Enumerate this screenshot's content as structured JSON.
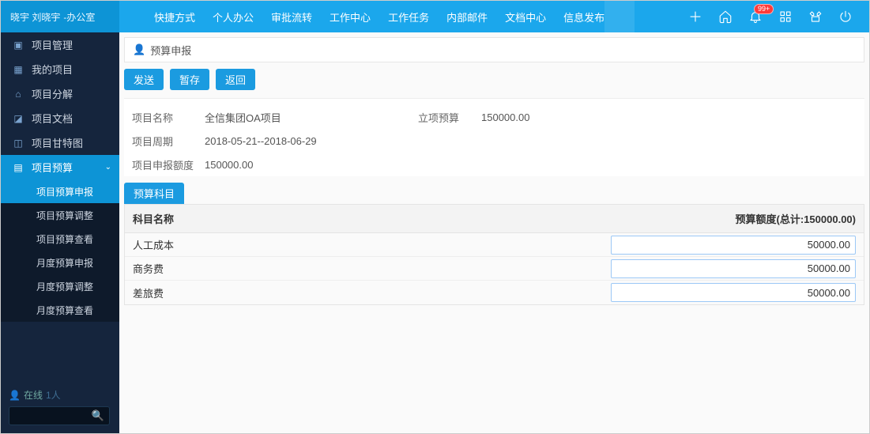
{
  "header": {
    "user_name": "晓宇 刘晓宇",
    "user_dept": "-办公室",
    "badge": "99+"
  },
  "topnav": [
    "快捷方式",
    "个人办公",
    "审批流转",
    "工作中心",
    "工作任务",
    "内部邮件",
    "文档中心",
    "信息发布"
  ],
  "sidebar": {
    "items": [
      "项目管理",
      "我的项目",
      "项目分解",
      "项目文档",
      "项目甘特图",
      "项目预算"
    ],
    "subs": [
      "项目预算申报",
      "项目预算调整",
      "项目预算查看",
      "月度预算申报",
      "月度预算调整",
      "月度预算查看"
    ],
    "online_label": "在线",
    "online_count": "1人"
  },
  "page": {
    "title": "预算申报"
  },
  "actions": {
    "send": "发送",
    "draft": "暂存",
    "back": "返回"
  },
  "form": {
    "labels": {
      "project_name": "项目名称",
      "budget": "立项预算",
      "period": "项目周期",
      "declared": "项目申报额度"
    },
    "values": {
      "project_name": "全信集团OA项目",
      "budget": "150000.00",
      "period": "2018-05-21--2018-06-29",
      "declared": "150000.00"
    }
  },
  "subject_tab": "预算科目",
  "table": {
    "columns": {
      "name": "科目名称",
      "amount": "预算额度(总计:150000.00)"
    },
    "rows": [
      {
        "name": "人工成本",
        "amount": "50000.00"
      },
      {
        "name": "商务费",
        "amount": "50000.00"
      },
      {
        "name": "差旅费",
        "amount": "50000.00"
      }
    ]
  }
}
